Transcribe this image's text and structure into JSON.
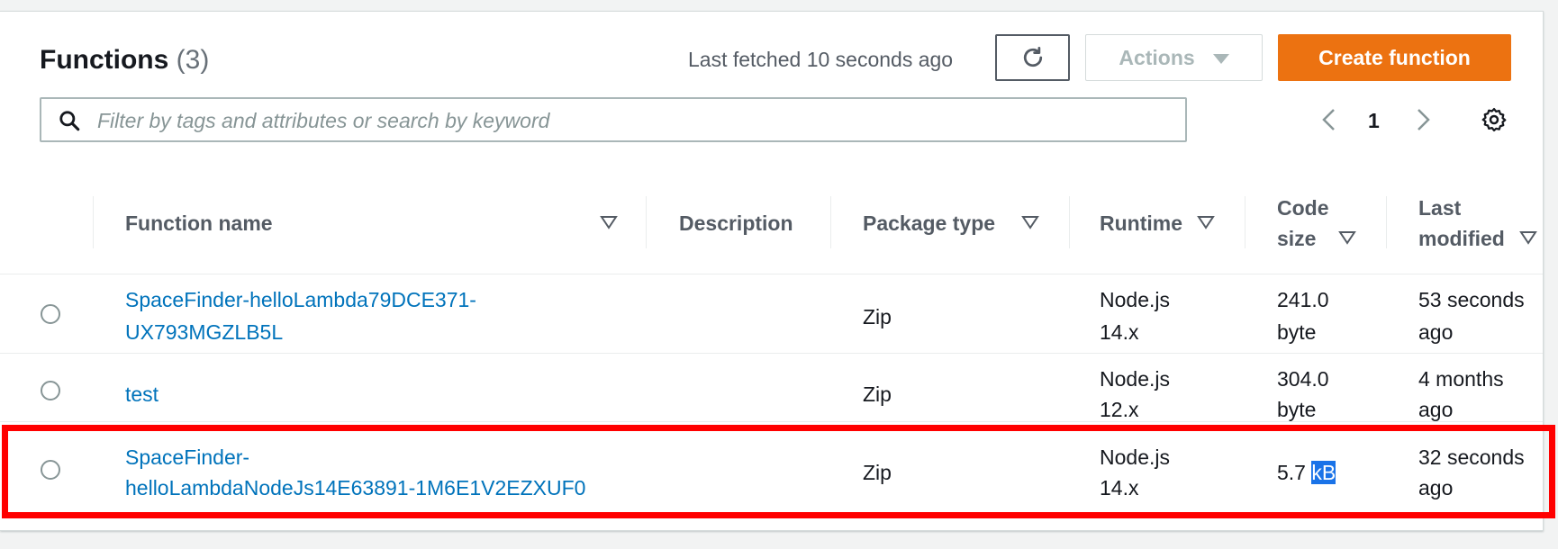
{
  "header": {
    "title": "Functions",
    "count": "(3)",
    "last_fetched": "Last fetched 10 seconds ago",
    "refresh_icon": "refresh-icon",
    "actions_label": "Actions",
    "create_label": "Create function"
  },
  "search": {
    "placeholder": "Filter by tags and attributes or search by keyword",
    "value": ""
  },
  "pagination": {
    "current_page": "1"
  },
  "columns": {
    "function_name": "Function name",
    "description": "Description",
    "package_type": "Package type",
    "runtime": "Runtime",
    "code_size_1": "Code",
    "code_size_2": "size",
    "last_modified_1": "Last",
    "last_modified_2": "modified"
  },
  "rows": [
    {
      "name_1": "SpaceFinder-helloLambda79DCE371-",
      "name_2": "UX793MGZLB5L",
      "package": "Zip",
      "runtime_1": "Node.js",
      "runtime_2": "14.x",
      "size_1": "241.0",
      "size_2": "byte",
      "modified_1": "53 seconds",
      "modified_2": "ago"
    },
    {
      "name_1": "test",
      "package": "Zip",
      "runtime_1": "Node.js",
      "runtime_2": "12.x",
      "size_1": "304.0",
      "size_2": "byte",
      "modified_1": "4 months",
      "modified_2": "ago"
    },
    {
      "name_1": "SpaceFinder-",
      "name_2": "helloLambdaNodeJs14E63891-1M6E1V2EZXUF0",
      "package": "Zip",
      "runtime_1": "Node.js",
      "runtime_2": "14.x",
      "size_num": "5.7",
      "size_unit": "kB",
      "modified_1": "32 seconds",
      "modified_2": "ago"
    }
  ],
  "colors": {
    "accent": "#ec7211",
    "link": "#0073bb",
    "highlight_box": "#ff0000"
  }
}
